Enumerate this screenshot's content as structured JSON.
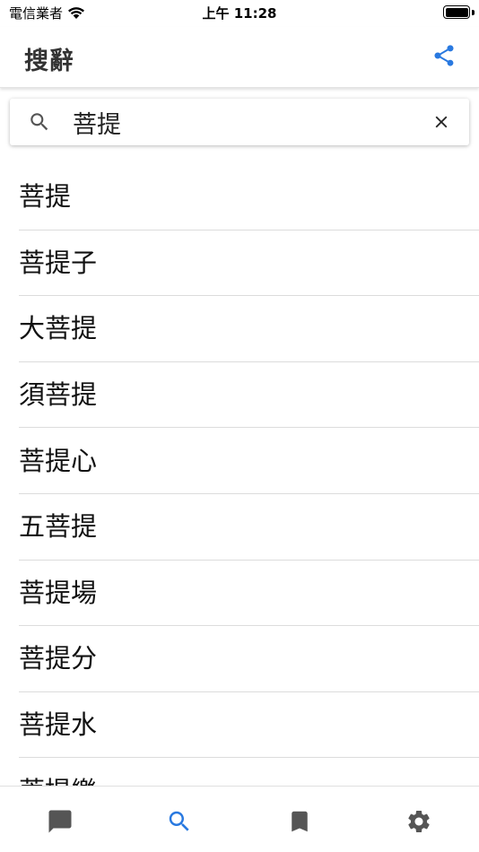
{
  "status_bar": {
    "carrier": "電信業者",
    "time": "上午 11:28"
  },
  "app_bar": {
    "title": "搜辭",
    "share_icon": "share-icon"
  },
  "search": {
    "query": "菩提",
    "search_icon": "search-icon",
    "clear_icon": "close-icon"
  },
  "results": [
    "菩提",
    "菩提子",
    "大菩提",
    "須菩提",
    "菩提心",
    "五菩提",
    "菩提場",
    "菩提分",
    "菩提水",
    "菩提樂"
  ],
  "tabs": [
    {
      "icon": "chat-bubble-icon",
      "active": false
    },
    {
      "icon": "search-icon",
      "active": true
    },
    {
      "icon": "bookmark-icon",
      "active": false
    },
    {
      "icon": "gear-icon",
      "active": false
    }
  ],
  "colors": {
    "accent": "#2979e0",
    "icon_inactive": "#555555",
    "title": "#333333"
  }
}
